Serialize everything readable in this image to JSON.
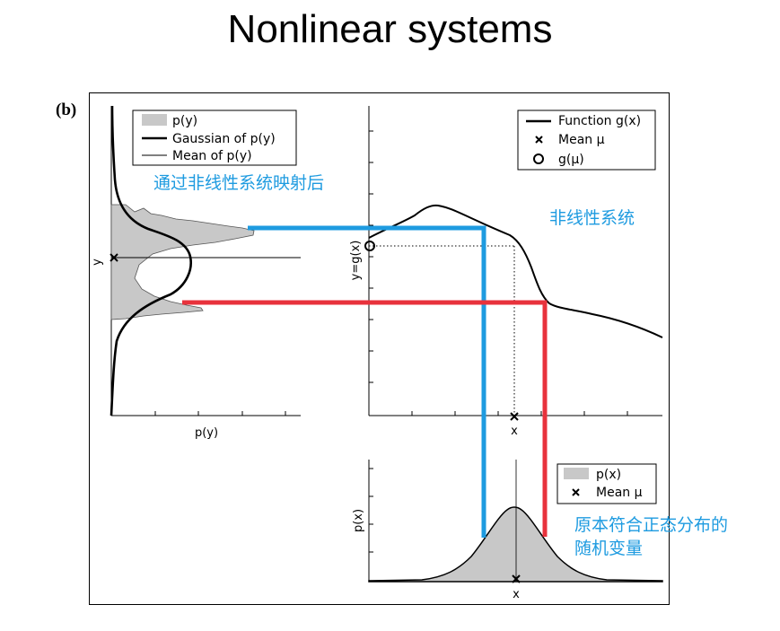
{
  "slide": {
    "title": "Nonlinear systems"
  },
  "figure": {
    "panel_label": "(b)",
    "left_panel": {
      "legend": [
        "p(y)",
        "Gaussian of p(y)",
        "Mean of p(y)"
      ],
      "xlabel": "p(y)",
      "ylabel": "y"
    },
    "top_panel": {
      "legend": [
        "Function g(x)",
        "Mean μ",
        "g(μ)"
      ],
      "xlabel": "x",
      "ylabel": "y=g(x)"
    },
    "bottom_panel": {
      "legend": [
        "p(x)",
        "Mean μ"
      ],
      "xlabel": "x",
      "ylabel": "p(x)"
    },
    "annotations": {
      "after_mapping": "通过非线性系统映射后",
      "nonlinear_system": "非线性系统",
      "original_line1": "原本符合正态分布的",
      "original_line2": "随机变量"
    },
    "colors": {
      "blue_guide": "#1e9be0",
      "red_guide": "#e8323c",
      "fill_gray": "#c8c8c8"
    }
  }
}
